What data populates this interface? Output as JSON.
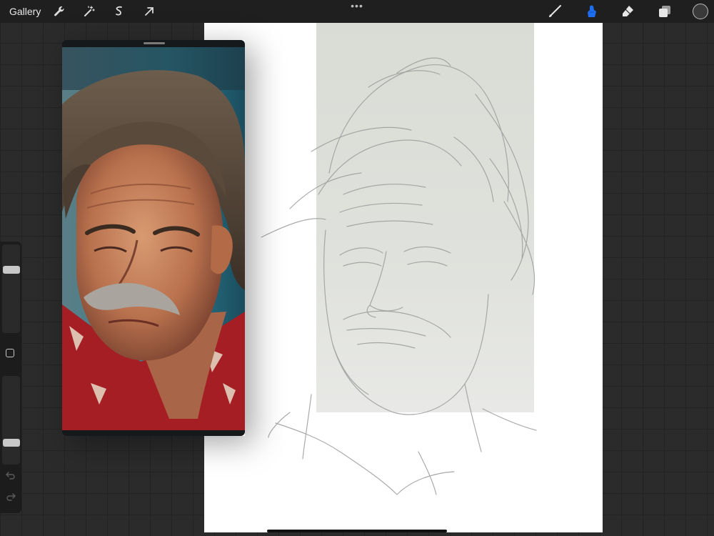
{
  "topbar": {
    "gallery_label": "Gallery",
    "more_label": "•••",
    "tools": [
      "wrench-icon",
      "magic-wand-icon",
      "selection-icon",
      "arrow-icon"
    ],
    "brush_tools": [
      "brush-icon",
      "smudge-icon",
      "eraser-icon",
      "layers-icon"
    ],
    "active_tool_color": "#1e6cf0",
    "current_color": "#3a3a3a"
  },
  "sidebar": {
    "undo_icon": "undo-icon",
    "redo_icon": "redo-icon",
    "modifier_icon": "modifier-square-icon"
  },
  "reference": {
    "title": "",
    "photo": "portrait-reference"
  }
}
